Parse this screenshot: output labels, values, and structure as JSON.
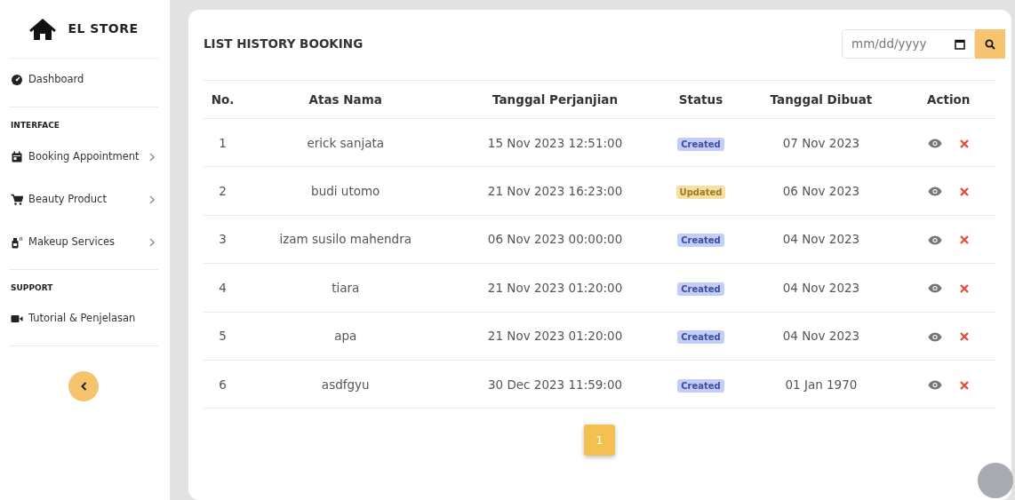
{
  "brand": {
    "title": "EL STORE"
  },
  "sidebar": {
    "sections": [
      {
        "items": [
          {
            "label": "Dashboard",
            "submenu": false
          }
        ]
      },
      {
        "heading": "INTERFACE",
        "items": [
          {
            "label": "Booking Appointment",
            "submenu": true
          },
          {
            "label": "Beauty Product",
            "submenu": true
          },
          {
            "label": "Makeup Services",
            "submenu": true
          }
        ]
      },
      {
        "heading": "SUPPORT",
        "items": [
          {
            "label": "Tutorial & Penjelasan",
            "submenu": false
          }
        ]
      }
    ]
  },
  "page": {
    "title": "LIST HISTORY BOOKING",
    "date_filter": {
      "placeholder": "mm/dd/yyyy"
    }
  },
  "table": {
    "columns": [
      "No.",
      "Atas Nama",
      "Tanggal Perjanjian",
      "Status",
      "Tanggal Dibuat",
      "Action"
    ],
    "rows": [
      {
        "no": "1",
        "name": "erick sanjata",
        "appointment": "15 Nov 2023 12:51:00",
        "status": "Created",
        "kind": "created",
        "created": "07 Nov 2023"
      },
      {
        "no": "2",
        "name": "budi utomo",
        "appointment": "21 Nov 2023 16:23:00",
        "status": "Updated",
        "kind": "updated",
        "created": "06 Nov 2023"
      },
      {
        "no": "3",
        "name": "izam susilo mahendra",
        "appointment": "06 Nov 2023 00:00:00",
        "status": "Created",
        "kind": "created",
        "created": "04 Nov 2023"
      },
      {
        "no": "4",
        "name": "tiara",
        "appointment": "21 Nov 2023 01:20:00",
        "status": "Created",
        "kind": "created",
        "created": "04 Nov 2023"
      },
      {
        "no": "5",
        "name": "apa",
        "appointment": "21 Nov 2023 01:20:00",
        "status": "Created",
        "kind": "created",
        "created": "04 Nov 2023"
      },
      {
        "no": "6",
        "name": "asdfgyu",
        "appointment": "30 Dec 2023 11:59:00",
        "status": "Created",
        "kind": "created",
        "created": "01 Jan 1970"
      }
    ]
  },
  "pagination": [
    {
      "label": "1",
      "selected": true
    }
  ]
}
